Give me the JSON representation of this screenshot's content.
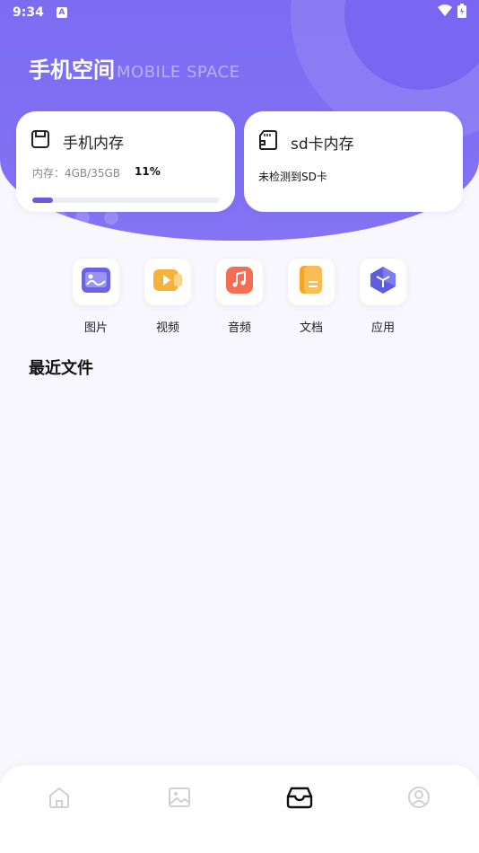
{
  "status_bar": {
    "time": "9:34",
    "notif_icon_letter": "A",
    "icons": [
      "wifi-icon",
      "battery-icon"
    ]
  },
  "header": {
    "title_cn": "手机空间",
    "title_en": "MOBILE SPACE"
  },
  "storage": {
    "phone": {
      "label": "手机内存",
      "usage_text": "内存：4GB/35GB",
      "percent_text": "11%",
      "percent": 11
    },
    "sd": {
      "label": "sd卡内存",
      "status_text": "未检测到SD卡"
    }
  },
  "categories": [
    {
      "label": "图片",
      "icon": "image-icon",
      "color": "#6b63e6"
    },
    {
      "label": "视频",
      "icon": "video-icon",
      "color": "#f7b23a"
    },
    {
      "label": "音频",
      "icon": "music-icon",
      "color": "#f56d52"
    },
    {
      "label": "文档",
      "icon": "document-icon",
      "color": "#f5a623"
    },
    {
      "label": "应用",
      "icon": "app-cube-icon",
      "color": "#5e5de0"
    }
  ],
  "recent": {
    "title": "最近文件"
  },
  "tabbar": {
    "tabs": [
      "home-icon",
      "gallery-icon",
      "storage-icon",
      "profile-icon"
    ],
    "active_index": 2
  },
  "colors": {
    "accent": "#7d6cf2",
    "progress": "#6c5ae6"
  }
}
